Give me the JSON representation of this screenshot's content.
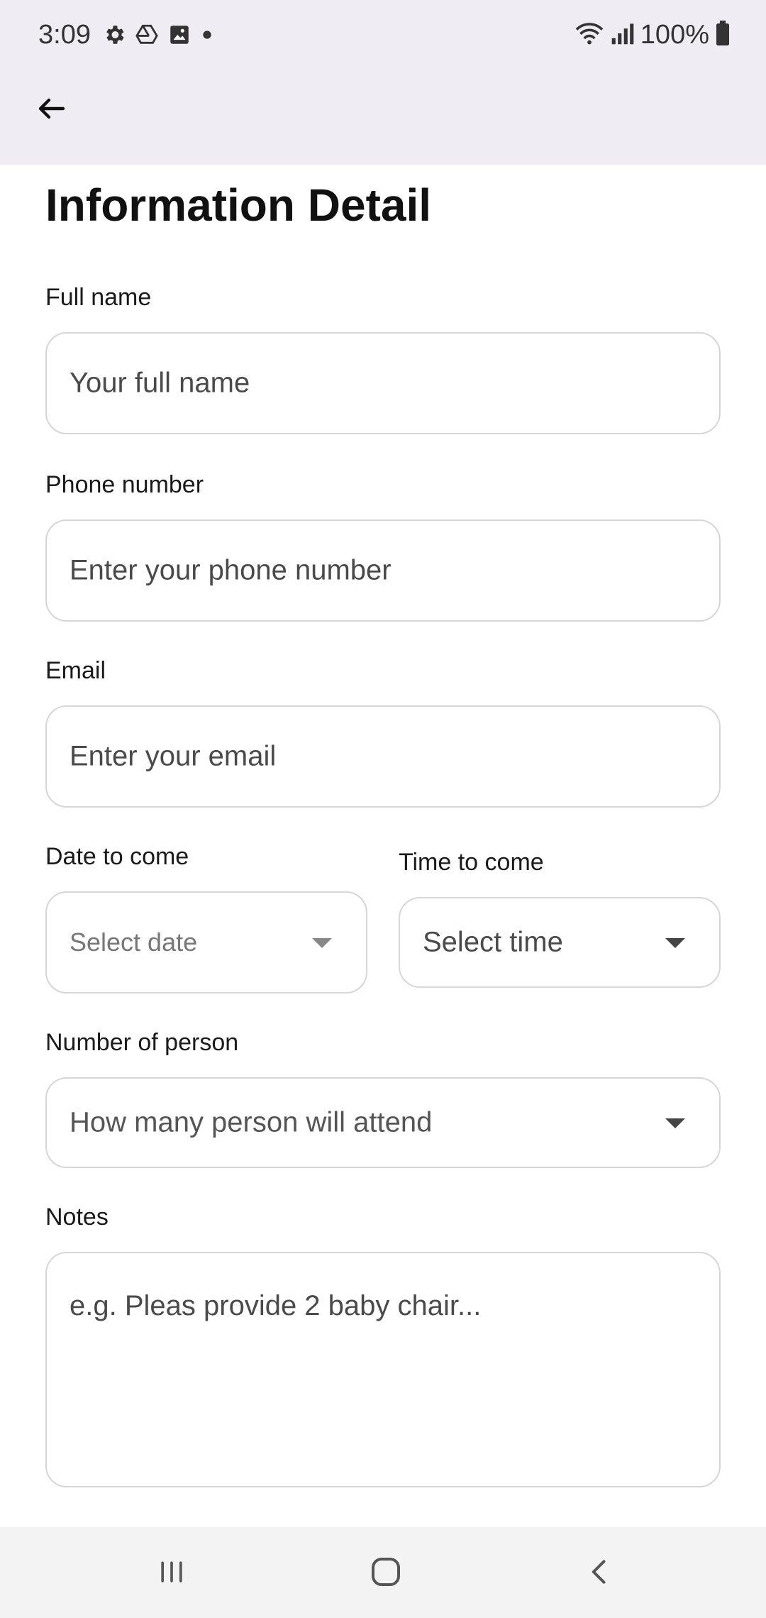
{
  "status_bar": {
    "time": "3:09",
    "left_icons": [
      "settings-icon",
      "drive-icon",
      "gallery-icon",
      "dot-icon"
    ],
    "right_icons": [
      "wifi-icon",
      "signal-icon",
      "battery-icon"
    ],
    "battery": "100%"
  },
  "app_bar": {
    "back_icon": "arrow-left-icon"
  },
  "page": {
    "title": "Information Detail"
  },
  "form": {
    "full_name": {
      "label": "Full name",
      "placeholder": "Your full name"
    },
    "phone": {
      "label": "Phone number",
      "placeholder": "Enter your phone number"
    },
    "email": {
      "label": "Email",
      "placeholder": "Enter your email"
    },
    "date": {
      "label": "Date to come",
      "placeholder": "Select date"
    },
    "time": {
      "label": "Time to come",
      "placeholder": "Select time"
    },
    "persons": {
      "label": "Number of person",
      "placeholder": "How many person will attend"
    },
    "notes": {
      "label": "Notes",
      "placeholder": "e.g. Pleas provide 2 baby chair..."
    }
  },
  "nav_bar": {
    "items": [
      "recents-icon",
      "home-icon",
      "back-icon"
    ]
  },
  "colors": {
    "top_bar_bg": "#efedf3",
    "field_border": "#d6d6d6",
    "nav_bar_bg": "#f3f3f3"
  }
}
